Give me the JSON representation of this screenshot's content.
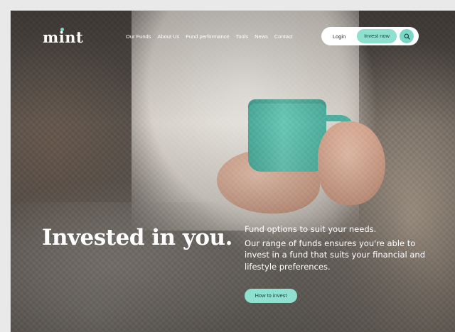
{
  "brand": {
    "logo_text": "mint",
    "accent_color": "#8fe0cf"
  },
  "nav": {
    "items": [
      {
        "label": "Our Funds"
      },
      {
        "label": "About Us"
      },
      {
        "label": "Fund performance"
      },
      {
        "label": "Tools"
      },
      {
        "label": "News"
      },
      {
        "label": "Contact"
      }
    ]
  },
  "auth": {
    "login_label": "Login",
    "invest_label": "Invest now",
    "search_icon": "search-icon"
  },
  "hero": {
    "title": "Invested in you.",
    "subtitle_line": "Fund options to suit your needs.",
    "description": "Our range of funds ensures you're able to invest in a fund that suits your financial and lifestyle preferences.",
    "cta_label": "How to invest"
  }
}
